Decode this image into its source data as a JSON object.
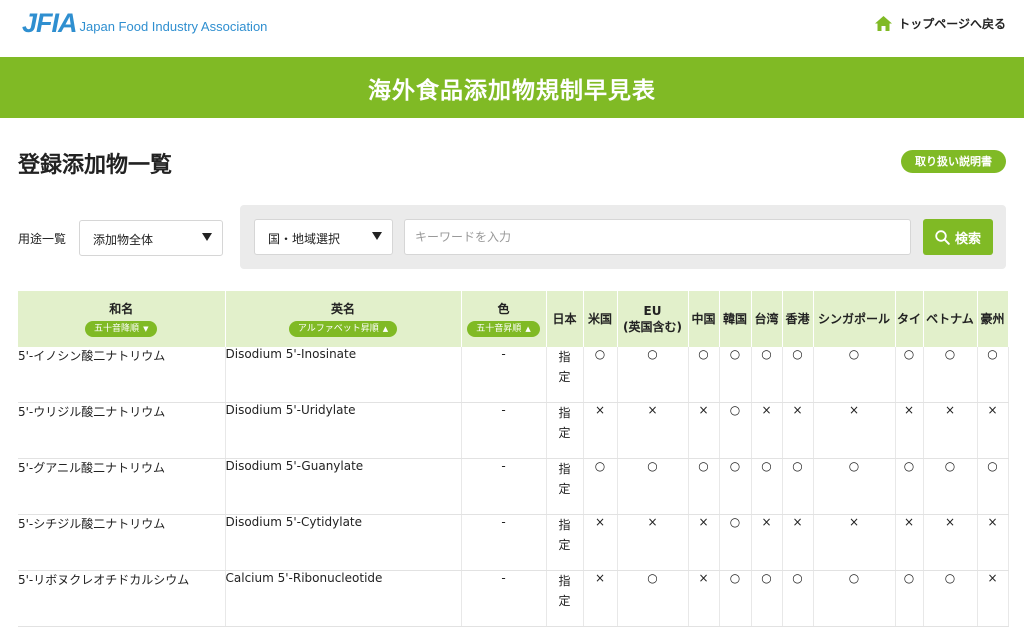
{
  "header": {
    "logo_mark": "JFIA",
    "logo_text": "Japan Food Industry Association",
    "home_link": "トップページへ戻る"
  },
  "banner": {
    "title": "海外食品添加物規制早見表"
  },
  "page": {
    "title": "登録添加物一覧",
    "manual_button": "取り扱い説明書"
  },
  "filters": {
    "usage_label": "用途一覧",
    "usage_selected": "添加物全体",
    "country_selected": "国・地域選択",
    "keyword_placeholder": "キーワードを入力",
    "search_button": "検索"
  },
  "table": {
    "columns": {
      "ja": "和名",
      "ja_sort": "五十音降順",
      "ja_sort_dir": "▼",
      "en": "英名",
      "en_sort": "アルファベット昇順",
      "en_sort_dir": "▲",
      "color": "色",
      "color_sort": "五十音昇順",
      "color_sort_dir": "▲",
      "jp": "日本",
      "us": "米国",
      "eu": "EU",
      "eu_sub": "(英国含む)",
      "cn": "中国",
      "kr": "韓国",
      "tw": "台湾",
      "hk": "香港",
      "sg": "シンガポール",
      "th": "タイ",
      "vn": "ベトナム",
      "au": "豪州"
    },
    "rows": [
      {
        "ja": "5'-イノシン酸二ナトリウム",
        "en": "Disodium 5'-Inosinate",
        "color": "-",
        "jp": "指\n定",
        "marks": [
          "○",
          "○",
          "○",
          "○",
          "○",
          "○",
          "○",
          "○",
          "○",
          "○"
        ]
      },
      {
        "ja": "5'-ウリジル酸二ナトリウム",
        "en": "Disodium 5'-Uridylate",
        "color": "-",
        "jp": "指\n定",
        "marks": [
          "×",
          "×",
          "×",
          "○",
          "×",
          "×",
          "×",
          "×",
          "×",
          "×"
        ]
      },
      {
        "ja": "5'-グアニル酸二ナトリウム",
        "en": "Disodium 5'-Guanylate",
        "color": "-",
        "jp": "指\n定",
        "marks": [
          "○",
          "○",
          "○",
          "○",
          "○",
          "○",
          "○",
          "○",
          "○",
          "○"
        ]
      },
      {
        "ja": "5'-シチジル酸二ナトリウム",
        "en": "Disodium 5'-Cytidylate",
        "color": "-",
        "jp": "指\n定",
        "marks": [
          "×",
          "×",
          "×",
          "○",
          "×",
          "×",
          "×",
          "×",
          "×",
          "×"
        ]
      },
      {
        "ja": "5'-リボヌクレオチドカルシウム",
        "en": "Calcium 5'-Ribonucleotide",
        "color": "-",
        "jp": "指\n定",
        "marks": [
          "×",
          "○",
          "×",
          "○",
          "○",
          "○",
          "○",
          "○",
          "○",
          "×"
        ]
      }
    ]
  }
}
